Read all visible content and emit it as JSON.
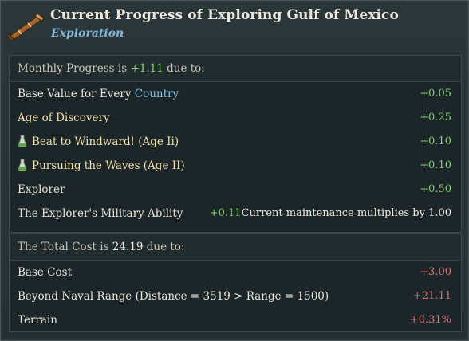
{
  "header": {
    "title": "Current Progress of Exploring Gulf of Mexico",
    "subtitle": "Exploration",
    "icon": "spyglass-icon"
  },
  "progress": {
    "head_prefix": "Monthly Progress is",
    "head_value": "+1.11",
    "head_suffix": "due to:",
    "rows": [
      {
        "label_pre": "Base Value for Every",
        "label_link": "Country",
        "value": "+0.05"
      },
      {
        "label": "Age of Discovery",
        "value": "+0.25"
      },
      {
        "label": "Beat to Windward! (Age Ii)",
        "value": "+0.10",
        "icon": "flask-icon"
      },
      {
        "label": "Pursuing the Waves (Age II)",
        "value": "+0.10",
        "icon": "flask-icon"
      },
      {
        "label": "Explorer",
        "value": "+0.50"
      },
      {
        "label": "The Explorer's Military Ability",
        "value": "+0.11",
        "note": "Current maintenance multiplies by 1.00"
      }
    ]
  },
  "cost": {
    "head_prefix": "The Total Cost is",
    "head_value": "24.19",
    "head_suffix": "due to:",
    "rows": [
      {
        "label": "Base Cost",
        "value": "+3.00"
      },
      {
        "label": "Beyond Naval Range (Distance = 3519 > Range = 1500)",
        "value": "+21.11"
      },
      {
        "label": "Terrain",
        "value": "+0.31%"
      }
    ]
  },
  "colors": {
    "positive": "#7fd36a",
    "negative": "#e07070",
    "link": "#7fc3e6",
    "highlight": "#efe0a8"
  }
}
